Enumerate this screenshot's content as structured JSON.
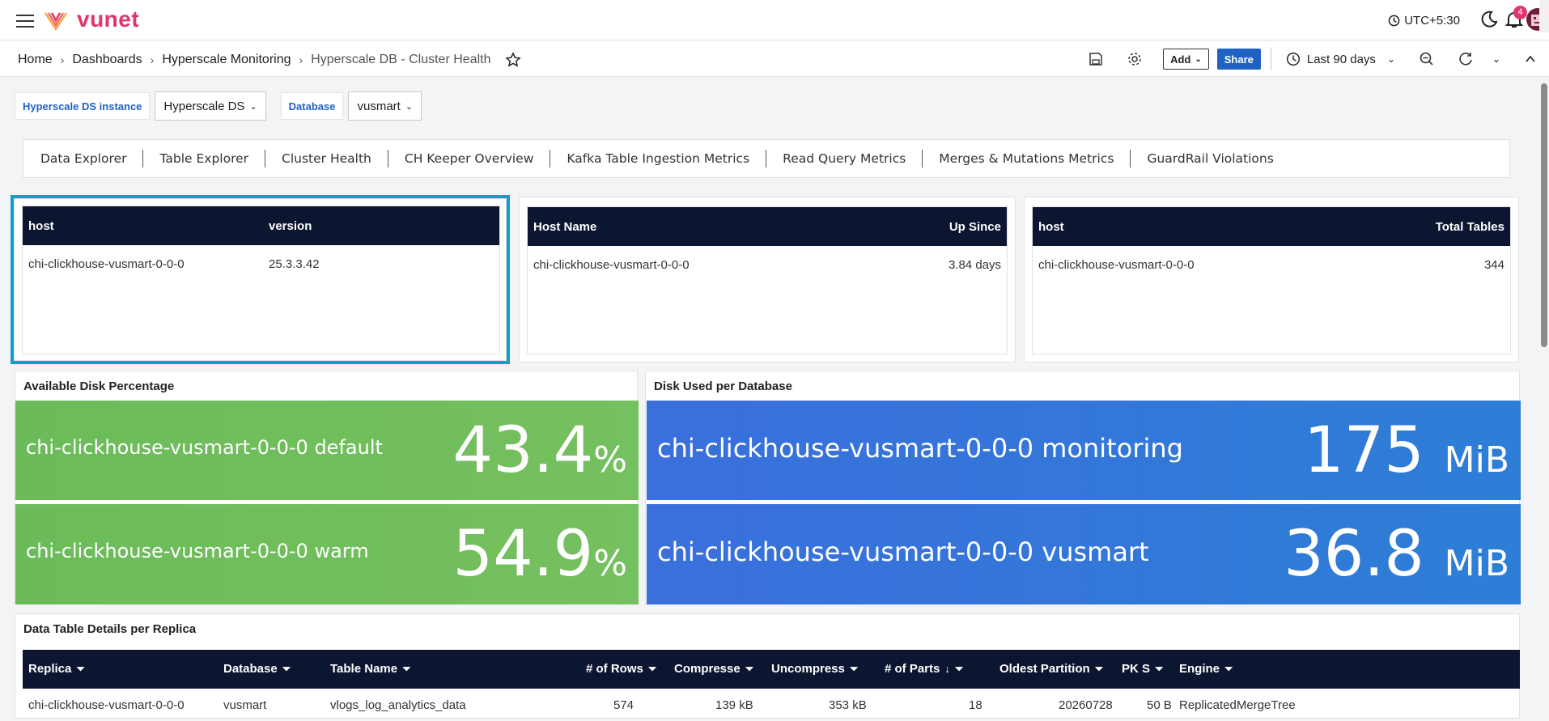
{
  "app": {
    "logo_text": "vunet",
    "timezone": "UTC+5:30",
    "notifications_count": "4"
  },
  "breadcrumb": [
    "Home",
    "Dashboards",
    "Hyperscale Monitoring",
    "Hyperscale DB - Cluster Health"
  ],
  "toolbar": {
    "add_label": "Add",
    "share_label": "Share",
    "time_range": "Last 90 days"
  },
  "filters": [
    {
      "label": "Hyperscale DS instance",
      "value": "Hyperscale DS"
    },
    {
      "label": "Database",
      "value": "vusmart"
    }
  ],
  "tabs": [
    "Data Explorer",
    "Table Explorer",
    "Cluster Health",
    "CH Keeper Overview",
    "Kafka Table Ingestion Metrics",
    "Read Query Metrics",
    "Merges & Mutations Metrics",
    "GuardRail Violations"
  ],
  "panel_versions": {
    "headers": [
      "host",
      "version"
    ],
    "rows": [
      [
        "chi-clickhouse-vusmart-0-0-0",
        "25.3.3.42"
      ]
    ]
  },
  "panel_uptime": {
    "headers": [
      "Host Name",
      "Up Since"
    ],
    "rows": [
      [
        "chi-clickhouse-vusmart-0-0-0",
        "3.84 days"
      ]
    ]
  },
  "panel_tables": {
    "headers": [
      "host",
      "Total Tables"
    ],
    "rows": [
      [
        "chi-clickhouse-vusmart-0-0-0",
        "344"
      ]
    ]
  },
  "disk_pct": {
    "title": "Available Disk Percentage",
    "items": [
      {
        "label": "chi-clickhouse-vusmart-0-0-0 default",
        "value": "43.4",
        "unit": "%"
      },
      {
        "label": "chi-clickhouse-vusmart-0-0-0 warm",
        "value": "54.9",
        "unit": "%"
      }
    ]
  },
  "disk_db": {
    "title": "Disk Used per Database",
    "items": [
      {
        "label": "chi-clickhouse-vusmart-0-0-0 monitoring",
        "value": "175",
        "unit": "MiB"
      },
      {
        "label": "chi-clickhouse-vusmart-0-0-0 vusmart",
        "value": "36.8",
        "unit": "MiB"
      }
    ]
  },
  "replica_table": {
    "title": "Data Table Details per Replica",
    "headers": [
      "Replica",
      "Database",
      "Table Name",
      "# of Rows",
      "Compresse",
      "Uncompress",
      "# of Parts",
      "Oldest Partition",
      "PK S",
      "Engine"
    ],
    "rows": [
      [
        "chi-clickhouse-vusmart-0-0-0",
        "vusmart",
        "vlogs_log_analytics_data",
        "574",
        "139 kB",
        "353 kB",
        "18",
        "20260728",
        "50 B",
        "ReplicatedMergeTree"
      ]
    ]
  },
  "colors": {
    "brand": "#e0356d",
    "header_bg": "#0c1630",
    "link": "#2062c4",
    "green_stat": "#6cbb5a",
    "blue_stat": "#3a6fdc",
    "highlight": "#0ba2c6"
  }
}
